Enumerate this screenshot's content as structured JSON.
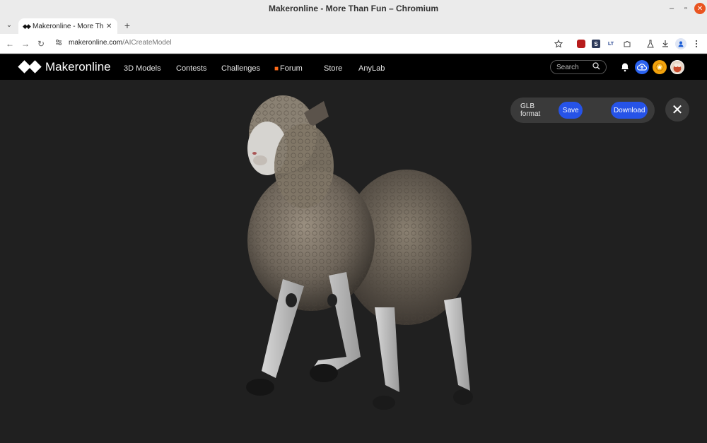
{
  "window": {
    "title": "Makeronline - More Than Fun – Chromium",
    "minimize": "–",
    "maximize": "▫",
    "close": "✕"
  },
  "tabs": {
    "menu_icon": "⌄",
    "active_title": "Makeronline - More Than Fun",
    "favicon": "◆◆",
    "close": "✕",
    "new_tab": "+"
  },
  "toolbar": {
    "back": "←",
    "forward": "→",
    "reload": "↻",
    "url_domain": "makeronline.com",
    "url_path": "/AICreateModel",
    "extensions": [
      "S",
      "LT"
    ]
  },
  "site": {
    "brand": "Makeronline",
    "nav": [
      "3D Models",
      "Contests",
      "Challenges",
      "Forum",
      "Store",
      "AnyLab"
    ],
    "search_placeholder": "Search"
  },
  "viewer": {
    "format_label": "GLB format",
    "save_label": "Save",
    "download_label": "Download",
    "close": "✕"
  }
}
